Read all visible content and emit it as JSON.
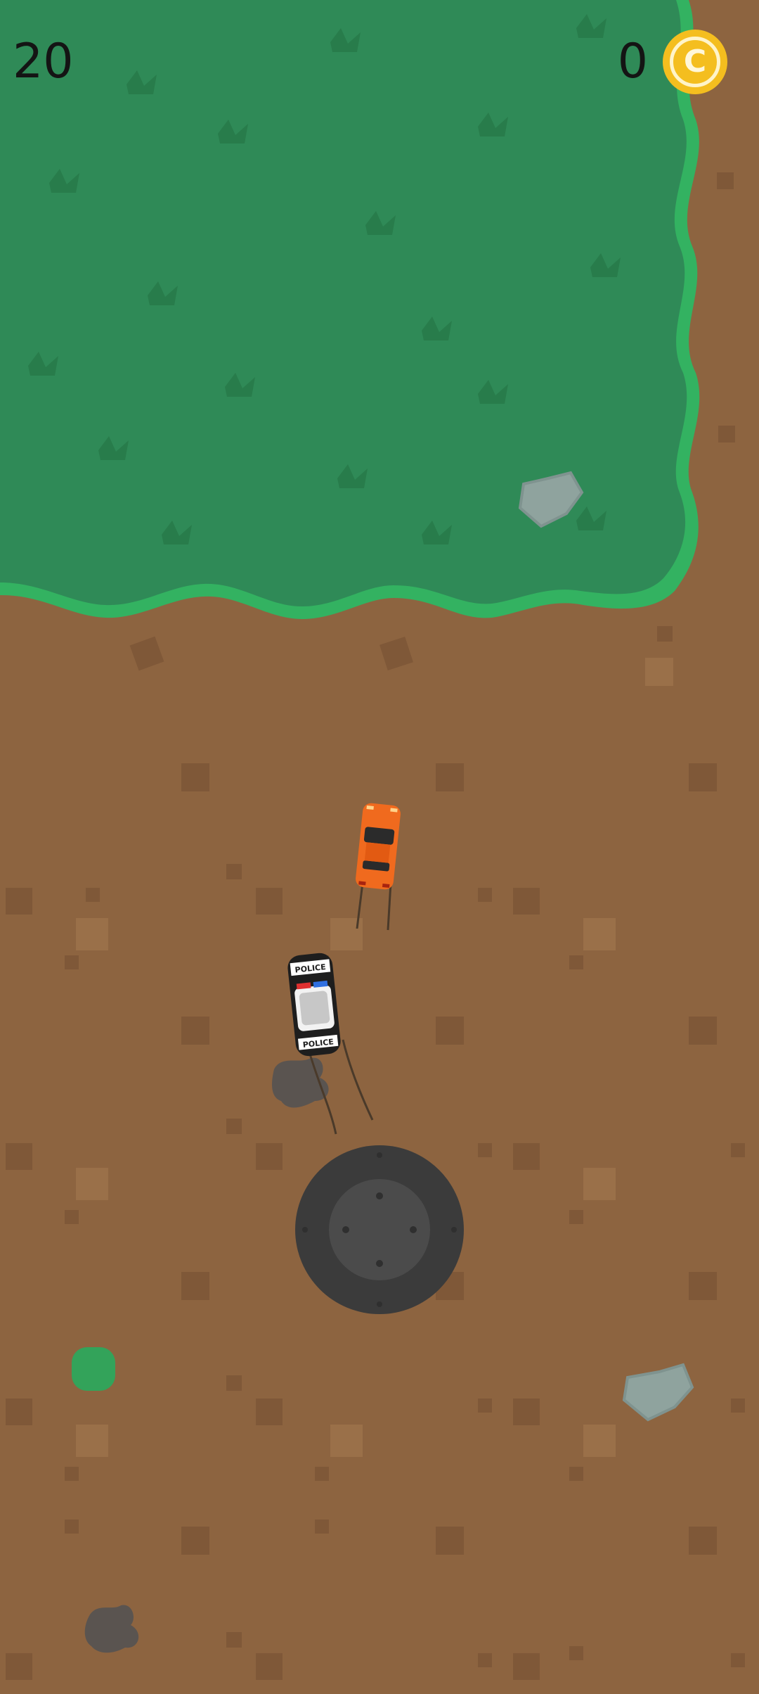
{
  "hud": {
    "score": "20",
    "coins": "0",
    "coin_icon_letter": "C"
  },
  "player_car": {
    "label": "POLICE",
    "color": "#f06a1e"
  },
  "police_car": {
    "label_front": "POLICE",
    "label_back": "POLICE"
  },
  "joystick": {
    "state": "idle"
  },
  "colors": {
    "dirt": "#8d6440",
    "grass": "#2f8a57",
    "grass_border": "#33b261",
    "coin": "#f4be1f"
  }
}
